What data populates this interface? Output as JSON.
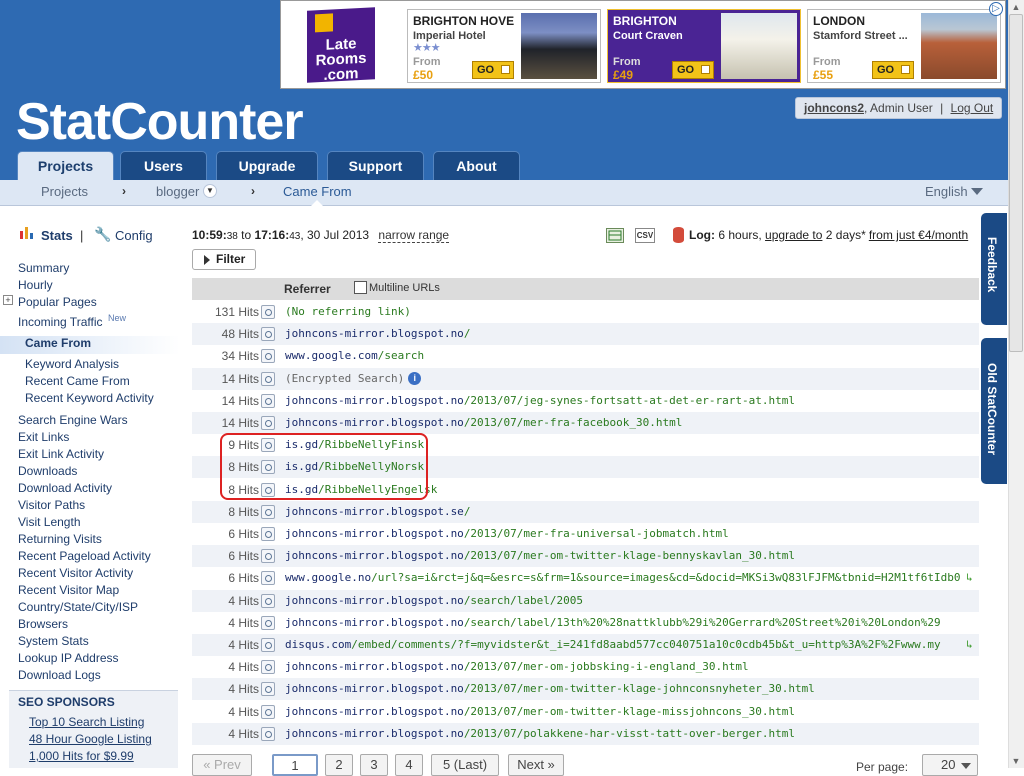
{
  "ad": {
    "logo_lines": [
      "Late",
      "Rooms",
      ".com"
    ],
    "items": [
      {
        "title": "BRIGHTON HOVE",
        "subtitle": "Imperial Hotel",
        "stars": "★★★",
        "from": "From",
        "price": "£50",
        "go": "GO"
      },
      {
        "title": "BRIGHTON",
        "subtitle": "Court Craven",
        "from": "From",
        "price": "£49",
        "go": "GO"
      },
      {
        "title": "LONDON",
        "subtitle": "Stamford Street ...",
        "from": "From",
        "price": "£55",
        "go": "GO"
      }
    ]
  },
  "header": {
    "logo_a": "StatC",
    "logo_b": "ounter",
    "user": "johncons2",
    "role": ", Admin User",
    "sep": "|",
    "logout": "Log Out"
  },
  "tabs": [
    "Projects",
    "Users",
    "Upgrade",
    "Support",
    "About"
  ],
  "subnav": {
    "projects": "Projects",
    "project": "blogger",
    "current": "Came From",
    "language": "English"
  },
  "sidebar": {
    "stats": "Stats",
    "sep": "|",
    "config": "Config",
    "links": [
      "Summary",
      "Hourly",
      "Popular Pages",
      "Incoming Traffic",
      "Came From",
      "Keyword Analysis",
      "Recent Came From",
      "Recent Keyword Activity",
      "Search Engine Wars",
      "Exit Links",
      "Exit Link Activity",
      "Downloads",
      "Download Activity",
      "Visitor Paths",
      "Visit Length",
      "Returning Visits",
      "Recent Pageload Activity",
      "Recent Visitor Activity",
      "Recent Visitor Map",
      "Country/State/City/ISP",
      "Browsers",
      "System Stats",
      "Lookup IP Address",
      "Download Logs"
    ],
    "new_badge": "New",
    "sponsors_title": "SEO SPONSORS",
    "sponsors": [
      "Top 10 Search Listing",
      "48 Hour Google Listing",
      "1,000 Hits for $9.99"
    ]
  },
  "toolbar": {
    "t1": "10:59:",
    "t1s": "38",
    "to": "to",
    "t2": "17:16:",
    "t2s": "43",
    "date": ", 30 Jul 2013",
    "narrow": "narrow range",
    "csv": "CSV",
    "log_label": "Log:",
    "log_text": "6 hours,",
    "upgrade": "upgrade to",
    "upgrade2": "2 days*",
    "price": "from just €4/month",
    "filter": "Filter"
  },
  "table": {
    "referrer_header": "Referrer",
    "multiline": "Multiline URLs",
    "rows": [
      {
        "hits": "131 Hits",
        "domain": "",
        "path": "(No referring link)"
      },
      {
        "hits": "48 Hits",
        "domain": "johncons-mirror.blogspot.no",
        "path": "/"
      },
      {
        "hits": "34 Hits",
        "domain": "www.google.com",
        "path": "/search"
      },
      {
        "hits": "14 Hits",
        "domain": "",
        "path": "(Encrypted Search)"
      },
      {
        "hits": "14 Hits",
        "domain": "johncons-mirror.blogspot.no",
        "path": "/2013/07/jeg-synes-fortsatt-at-det-er-rart-at.html"
      },
      {
        "hits": "14 Hits",
        "domain": "johncons-mirror.blogspot.no",
        "path": "/2013/07/mer-fra-facebook_30.html"
      },
      {
        "hits": "9 Hits",
        "domain": "is.gd",
        "path": "/RibbeNellyFinsk"
      },
      {
        "hits": "8 Hits",
        "domain": "is.gd",
        "path": "/RibbeNellyNorsk"
      },
      {
        "hits": "8 Hits",
        "domain": "is.gd",
        "path": "/RibbeNellyEngelsk"
      },
      {
        "hits": "8 Hits",
        "domain": "johncons-mirror.blogspot.se",
        "path": "/"
      },
      {
        "hits": "6 Hits",
        "domain": "johncons-mirror.blogspot.no",
        "path": "/2013/07/mer-fra-universal-jobmatch.html"
      },
      {
        "hits": "6 Hits",
        "domain": "johncons-mirror.blogspot.no",
        "path": "/2013/07/mer-om-twitter-klage-bennyskavlan_30.html"
      },
      {
        "hits": "6 Hits",
        "domain": "www.google.no",
        "path": "/url?sa=i&rct=j&q=&esrc=s&frm=1&source=images&cd=&docid=MKSi3wQ83lFJFM&tbnid=H2M1tf6tIdb0"
      },
      {
        "hits": "4 Hits",
        "domain": "johncons-mirror.blogspot.no",
        "path": "/search/label/2005"
      },
      {
        "hits": "4 Hits",
        "domain": "johncons-mirror.blogspot.no",
        "path": "/search/label/13th%20%28nattklubb%29i%20Gerrard%20Street%20i%20London%29"
      },
      {
        "hits": "4 Hits",
        "domain": "disqus.com",
        "path": "/embed/comments/?f=myvidster&t_i=241fd8aabd577cc040751a10c0cdb45b&t_u=http%3A%2F%2Fwww.my"
      },
      {
        "hits": "4 Hits",
        "domain": "johncons-mirror.blogspot.no",
        "path": "/2013/07/mer-om-jobbsking-i-england_30.html"
      },
      {
        "hits": "4 Hits",
        "domain": "johncons-mirror.blogspot.no",
        "path": "/2013/07/mer-om-twitter-klage-johnconsnyheter_30.html"
      },
      {
        "hits": "4 Hits",
        "domain": "johncons-mirror.blogspot.no",
        "path": "/2013/07/mer-om-twitter-klage-missjohncons_30.html"
      },
      {
        "hits": "4 Hits",
        "domain": "johncons-mirror.blogspot.no",
        "path": "/2013/07/polakkene-har-visst-tatt-over-berger.html"
      }
    ]
  },
  "pagination": {
    "prev": "« Prev",
    "pages": [
      "1",
      "2",
      "3",
      "4",
      "5 (Last)"
    ],
    "next": "Next »",
    "per_page_label": "Per page:",
    "per_page": "20"
  },
  "side_tabs": {
    "feedback": "Feedback",
    "old": "Old StatCounter"
  }
}
